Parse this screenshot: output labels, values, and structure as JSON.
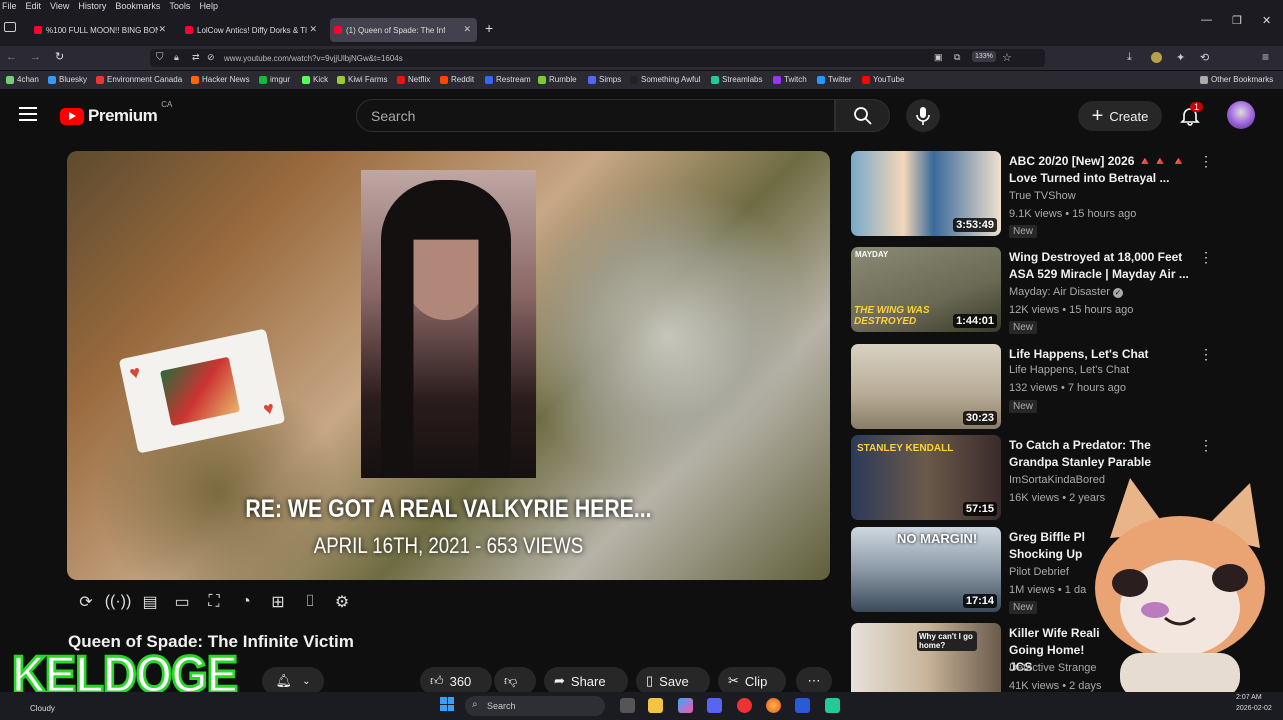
{
  "browser": {
    "menu": [
      "File",
      "Edit",
      "View",
      "History",
      "Bookmarks",
      "Tools",
      "Help"
    ],
    "tabs": [
      {
        "label": "%100 FULL MOON!! BING BON"
      },
      {
        "label": "LolCow Antics! Diffy Dorks & Tl"
      },
      {
        "label": "(1) Queen of Spade: The Inf"
      }
    ],
    "url": "www.youtube.com/watch?v=9vjjUlbjNGw&t=1604s",
    "zoom": "133%",
    "bookmarks": [
      "4chan",
      "Bluesky",
      "Environment Canada",
      "Hacker News",
      "imgur",
      "Kick",
      "Kiwi Farms",
      "Netflix",
      "Reddit",
      "Restream",
      "Rumble",
      "Simps",
      "Something Awful",
      "Streamlabs",
      "Twitch",
      "Twitter",
      "YouTube"
    ],
    "other_bookmarks": "Other Bookmarks"
  },
  "yt": {
    "logo": "Premium",
    "region": "CA",
    "search_placeholder": "Search",
    "create": "Create",
    "notif_count": "1"
  },
  "video": {
    "caption1": "RE: WE GOT A REAL VALKYRIE HERE...",
    "caption2": "APRIL 16TH, 2021 - 653 VIEWS",
    "title": "Queen of Spade: The Infinite Victim",
    "likes": "360",
    "share": "Share",
    "save": "Save",
    "clip": "Clip"
  },
  "recommendations": [
    {
      "title": "ABC 20/20 [New] 2026 🔺🔺 🔺 Love Turned into Betrayal ...",
      "channel": "True TVShow",
      "meta": "9.1K views • 15 hours ago",
      "duration": "3:53:49",
      "badge": "New",
      "thumb_color": "#4a6a8a"
    },
    {
      "title": "Wing Destroyed at 18,000 Feet ASA 529 Miracle | Mayday Air ...",
      "channel": "Mayday: Air Disaster",
      "meta": "12K views • 15 hours ago",
      "duration": "1:44:01",
      "badge": "New",
      "thumb_color": "#6a6a55",
      "thumb_text": "THE WING WAS DESTROYED",
      "thumb_top": "MAYDAY"
    },
    {
      "title": "Life Happens, Let's Chat",
      "channel": "Life Happens, Let's Chat",
      "meta": "132 views • 7 hours ago",
      "duration": "30:23",
      "badge": "New",
      "thumb_color": "#b7ab95"
    },
    {
      "title": "To Catch a Predator: The Grandpa Stanley Parable",
      "channel": "ImSortaKindaBored",
      "meta": "16K views • 2 years",
      "duration": "57:15",
      "badge": "",
      "thumb_color": "#3b4a6a",
      "thumb_text": "STANLEY KENDALL"
    },
    {
      "title": "Greg Biffle Pl Shocking Up",
      "channel": "Pilot Debrief",
      "meta": "1M views • 1 da",
      "duration": "17:14",
      "badge": "New",
      "thumb_color": "#5a6a7a",
      "thumb_text": "NO MARGIN!"
    },
    {
      "title": "Killer Wife Reali Going Home! JCS",
      "channel": "Detective Strange",
      "meta": "41K views • 2 days",
      "duration": "",
      "badge": "",
      "thumb_color": "#8a7a6a",
      "thumb_text": "Why can't I go home?"
    }
  ],
  "overlay": {
    "keldoge": "KELDOGE"
  },
  "taskbar": {
    "weather": "Cloudy",
    "search": "Search",
    "time": "2:07 AM",
    "date": "2026-02-02"
  }
}
